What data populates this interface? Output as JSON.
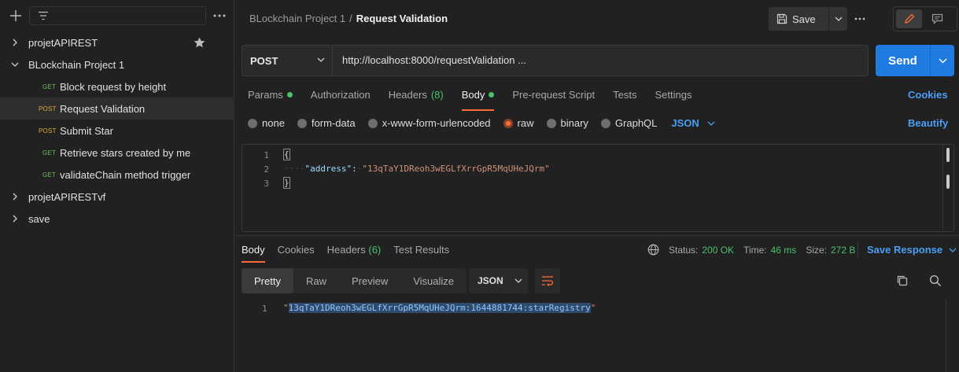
{
  "sidebar": {
    "collections": [
      {
        "name": "projetAPIREST",
        "expanded": false
      },
      {
        "name": "BLockchain Project 1",
        "expanded": true
      },
      {
        "name": "projetAPIRESTvf",
        "expanded": false
      },
      {
        "name": "save",
        "expanded": false
      }
    ],
    "requests": [
      {
        "method": "GET",
        "name": "Block request by height"
      },
      {
        "method": "POST",
        "name": "Request Validation",
        "selected": true
      },
      {
        "method": "POST",
        "name": "Submit Star"
      },
      {
        "method": "GET",
        "name": "Retrieve stars created by me"
      },
      {
        "method": "GET",
        "name": "validateChain method trigger"
      }
    ]
  },
  "header": {
    "collection": "BLockchain Project 1",
    "separator": "/",
    "request": "Request Validation",
    "save_label": "Save"
  },
  "request": {
    "method": "POST",
    "url": "http://localhost:8000/requestValidation ...",
    "send_label": "Send",
    "tabs": {
      "params": "Params",
      "authorization": "Authorization",
      "headers": "Headers",
      "headers_count": "(8)",
      "body": "Body",
      "prerequest": "Pre-request Script",
      "tests": "Tests",
      "settings": "Settings"
    },
    "cookies_label": "Cookies",
    "body_types": {
      "none": "none",
      "form_data": "form-data",
      "urlencoded": "x-www-form-urlencoded",
      "raw": "raw",
      "binary": "binary",
      "graphql": "GraphQL"
    },
    "language": "JSON",
    "beautify_label": "Beautify",
    "body_lines": {
      "ln1": "1",
      "ln2": "2",
      "ln3": "3",
      "open": "{",
      "indent": "····",
      "key": "\"address\"",
      "colon": ":",
      "value": "\"13qTaY1DReoh3wEGLfXrrGpR5MqUHeJQrm\"",
      "close": "}"
    }
  },
  "response": {
    "tabs": {
      "body": "Body",
      "cookies": "Cookies",
      "headers": "Headers",
      "headers_count": "(6)",
      "test_results": "Test Results"
    },
    "status_label": "Status:",
    "status_value": "200 OK",
    "time_label": "Time:",
    "time_value": "46 ms",
    "size_label": "Size:",
    "size_value": "272 B",
    "save_response_label": "Save Response",
    "views": {
      "pretty": "Pretty",
      "raw": "Raw",
      "preview": "Preview",
      "visualize": "Visualize"
    },
    "format": "JSON",
    "line_number": "1",
    "quote_open": "\"",
    "body_value": "13qTaY1DReoh3wEGLfXrrGpR5MqUHeJQrm:1644881744:starRegistry",
    "quote_close": "\""
  },
  "colors": {
    "accent": "#ff6c37",
    "link": "#4a9ff5",
    "send": "#1f7be0",
    "get": "#6bbd5b",
    "post": "#e0a93b",
    "success": "#49c06c"
  }
}
